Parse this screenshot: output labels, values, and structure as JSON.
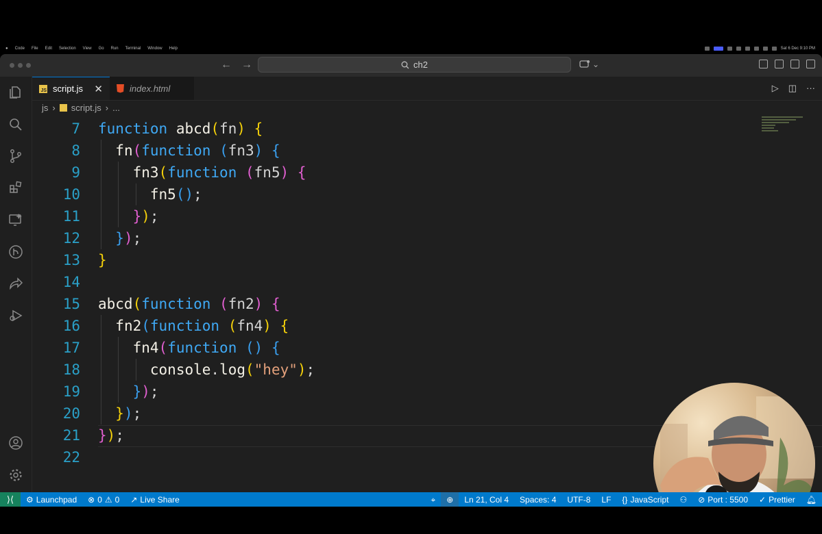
{
  "menubar": {
    "items": [
      "Code",
      "File",
      "Edit",
      "Selection",
      "View",
      "Go",
      "Run",
      "Terminal",
      "Window",
      "Help"
    ],
    "clock": "Sat 6 Dec 9:10 PM"
  },
  "titlebar": {
    "search_text": "ch2"
  },
  "tabs": [
    {
      "label": "script.js",
      "active": true
    },
    {
      "label": "index.html",
      "active": false
    }
  ],
  "breadcrumb": {
    "folder": "js",
    "file": "script.js",
    "more": "..."
  },
  "editor": {
    "lines": [
      {
        "n": "7",
        "indent": 0,
        "tokens": [
          [
            "kw",
            "function"
          ],
          [
            "p",
            " "
          ],
          [
            "fn",
            "abcd"
          ],
          [
            "b1",
            "("
          ],
          [
            "p",
            "fn"
          ],
          [
            "b1",
            ")"
          ],
          [
            "p",
            " "
          ],
          [
            "b1",
            "{"
          ]
        ]
      },
      {
        "n": "8",
        "indent": 1,
        "tokens": [
          [
            "fn",
            "fn"
          ],
          [
            "b2",
            "("
          ],
          [
            "kw",
            "function"
          ],
          [
            "p",
            " "
          ],
          [
            "b3",
            "("
          ],
          [
            "p",
            "fn3"
          ],
          [
            "b3",
            ")"
          ],
          [
            "p",
            " "
          ],
          [
            "b3",
            "{"
          ]
        ]
      },
      {
        "n": "9",
        "indent": 2,
        "tokens": [
          [
            "fn",
            "fn3"
          ],
          [
            "b1",
            "("
          ],
          [
            "kw",
            "function"
          ],
          [
            "p",
            " "
          ],
          [
            "b2",
            "("
          ],
          [
            "p",
            "fn5"
          ],
          [
            "b2",
            ")"
          ],
          [
            "p",
            " "
          ],
          [
            "b2",
            "{"
          ]
        ]
      },
      {
        "n": "10",
        "indent": 3,
        "tokens": [
          [
            "fn",
            "fn5"
          ],
          [
            "b3",
            "()"
          ],
          [
            "p",
            ";"
          ]
        ]
      },
      {
        "n": "11",
        "indent": 2,
        "tokens": [
          [
            "b2",
            "}"
          ],
          [
            "b1",
            ")"
          ],
          [
            "p",
            ";"
          ]
        ]
      },
      {
        "n": "12",
        "indent": 1,
        "tokens": [
          [
            "b3",
            "}"
          ],
          [
            "b2",
            ")"
          ],
          [
            "p",
            ";"
          ]
        ]
      },
      {
        "n": "13",
        "indent": 0,
        "tokens": [
          [
            "b1",
            "}"
          ]
        ]
      },
      {
        "n": "14",
        "indent": 0,
        "tokens": []
      },
      {
        "n": "15",
        "indent": 0,
        "tokens": [
          [
            "fn",
            "abcd"
          ],
          [
            "b1",
            "("
          ],
          [
            "kw",
            "function"
          ],
          [
            "p",
            " "
          ],
          [
            "b2",
            "("
          ],
          [
            "p",
            "fn2"
          ],
          [
            "b2",
            ")"
          ],
          [
            "p",
            " "
          ],
          [
            "b2",
            "{"
          ]
        ]
      },
      {
        "n": "16",
        "indent": 1,
        "tokens": [
          [
            "fn",
            "fn2"
          ],
          [
            "b3",
            "("
          ],
          [
            "kw",
            "function"
          ],
          [
            "p",
            " "
          ],
          [
            "b1",
            "("
          ],
          [
            "p",
            "fn4"
          ],
          [
            "b1",
            ")"
          ],
          [
            "p",
            " "
          ],
          [
            "b1",
            "{"
          ]
        ]
      },
      {
        "n": "17",
        "indent": 2,
        "tokens": [
          [
            "fn",
            "fn4"
          ],
          [
            "b2",
            "("
          ],
          [
            "kw",
            "function"
          ],
          [
            "p",
            " "
          ],
          [
            "b3",
            "()"
          ],
          [
            "p",
            " "
          ],
          [
            "b3",
            "{"
          ]
        ]
      },
      {
        "n": "18",
        "indent": 3,
        "tokens": [
          [
            "fn",
            "console"
          ],
          [
            "p",
            "."
          ],
          [
            "fn",
            "log"
          ],
          [
            "b1",
            "("
          ],
          [
            "str",
            "\"hey\""
          ],
          [
            "b1",
            ")"
          ],
          [
            "p",
            ";"
          ]
        ]
      },
      {
        "n": "19",
        "indent": 2,
        "tokens": [
          [
            "b3",
            "}"
          ],
          [
            "b2",
            ")"
          ],
          [
            "p",
            ";"
          ]
        ]
      },
      {
        "n": "20",
        "indent": 1,
        "tokens": [
          [
            "b1",
            "}"
          ],
          [
            "b3",
            ")"
          ],
          [
            "p",
            ";"
          ]
        ]
      },
      {
        "n": "21",
        "indent": 0,
        "tokens": [
          [
            "b2",
            "}"
          ],
          [
            "b1",
            ")"
          ],
          [
            "p",
            ";"
          ]
        ]
      },
      {
        "n": "22",
        "indent": 0,
        "tokens": []
      }
    ]
  },
  "statusbar": {
    "launchpad": "Launchpad",
    "errors": "0",
    "warnings": "0",
    "live_share": "Live Share",
    "position": "Ln 21, Col 4",
    "spaces": "Spaces: 4",
    "encoding": "UTF-8",
    "eol": "LF",
    "language": "JavaScript",
    "port": "Port : 5500",
    "prettier": "Prettier"
  },
  "icons": {
    "activity": [
      "explorer-icon",
      "search-icon",
      "source-control-icon",
      "extensions-icon",
      "remote-explorer-icon",
      "git-graph-icon",
      "live-share-icon",
      "run-debug-icon",
      "account-icon",
      "settings-icon"
    ]
  },
  "colors": {
    "statusbar": "#007acc",
    "keyword": "#3fa9f5",
    "bracket_yellow": "#f6d20a",
    "bracket_pink": "#e25fd1",
    "bracket_blue": "#3aa0f0",
    "string": "#e3a07b",
    "line_number": "#2aa0c8"
  }
}
